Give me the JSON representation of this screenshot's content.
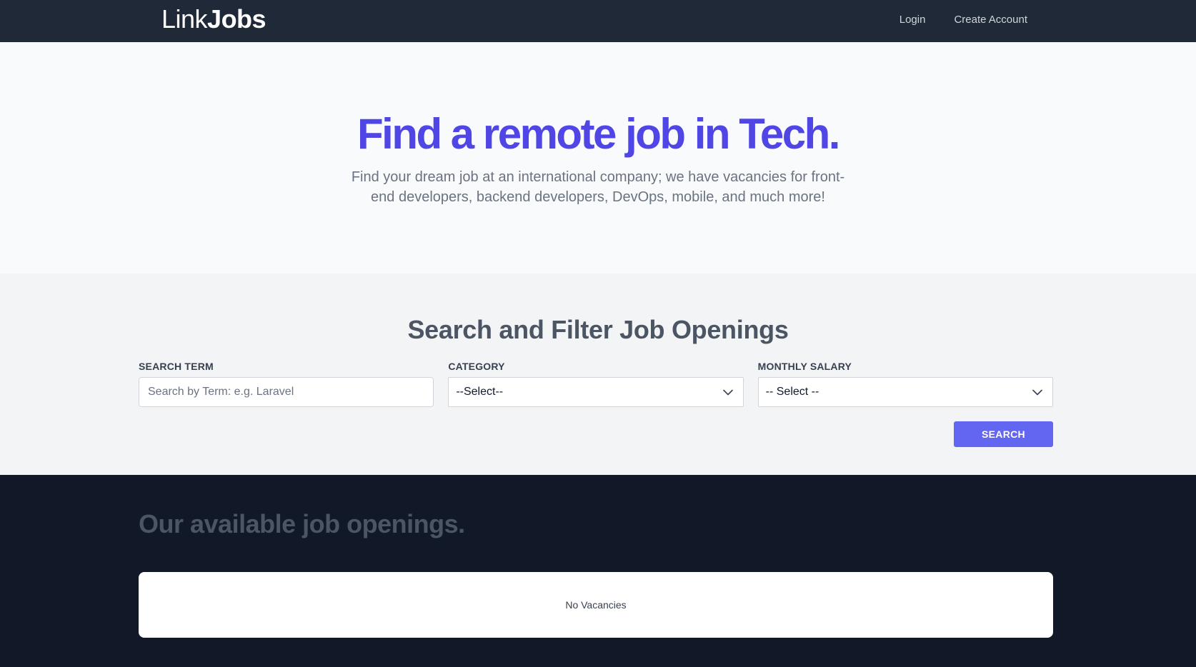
{
  "nav": {
    "brand_light": "Link",
    "brand_bold": "Jobs",
    "links": [
      {
        "label": "Login"
      },
      {
        "label": "Create Account"
      }
    ]
  },
  "hero": {
    "title": "Find a remote job in Tech.",
    "subtitle": "Find your dream job at an international company; we have vacancies for front-end developers, backend developers, DevOps, mobile, and much more!"
  },
  "filters": {
    "title": "Search and Filter Job Openings",
    "search_term": {
      "label": "Search Term",
      "value": "",
      "placeholder": "Search by Term: e.g. Laravel"
    },
    "category": {
      "label": "Category",
      "selected": "--Select--"
    },
    "salary": {
      "label": "Monthly Salary",
      "selected": "-- Select --"
    },
    "search_button": "Search"
  },
  "openings": {
    "title": "Our available job openings.",
    "empty_message": "No Vacancies"
  },
  "colors": {
    "nav_bg": "#1f2937",
    "accent": "#4f46e5",
    "button": "#6366f1",
    "footer_bg": "#111827"
  }
}
